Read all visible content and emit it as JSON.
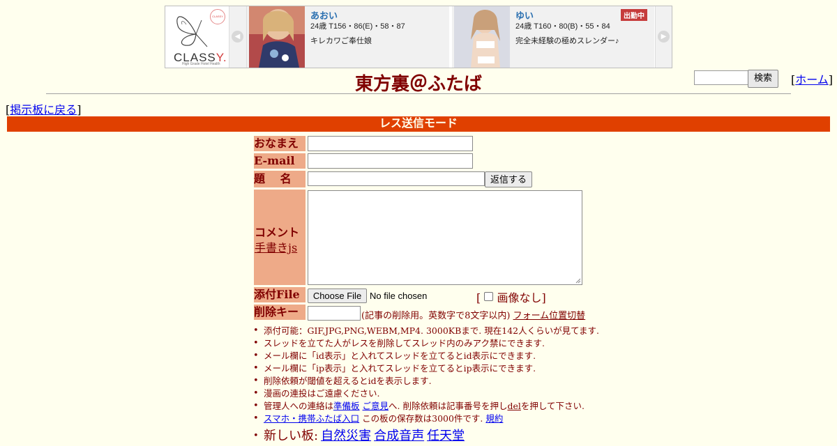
{
  "ad": {
    "logo_text": "CLASSY.",
    "logo_sub": "High Grade Hotel Health",
    "cards": [
      {
        "name": "あおい",
        "spec": "24歳 T156・86(E)・58・87",
        "desc": "キレカワご奉仕娘",
        "badge": ""
      },
      {
        "name": "ゆい",
        "spec": "24歳 T160・80(B)・55・84",
        "desc": "完全未経験の極めスレンダー♪",
        "badge": "出勤中"
      }
    ]
  },
  "header": {
    "title": "東方裏＠ふたば",
    "search_button": "検索",
    "home_prefix": "[",
    "home_link": "ホーム",
    "home_suffix": "]"
  },
  "nav": {
    "back_prefix": "[",
    "back_link": "掲示板に戻る",
    "back_suffix": "]"
  },
  "mode_banner": "レス送信モード",
  "form": {
    "name_label": "おなまえ",
    "email_label": "E-mail",
    "subject_label": "題　 名",
    "submit_button": "返信する",
    "comment_label": "コメント",
    "handwrite_link": "手書きjs",
    "file_label": "添付File",
    "file_button": "Choose File",
    "file_status": "No file chosen",
    "noimage_open": "[",
    "noimage_label": "画像なし",
    "noimage_close": "]",
    "delkey_label": "削除キー",
    "delkey_note": "(記事の削除用。英数字で8文字以内)",
    "form_toggle_link": "フォーム位置切替"
  },
  "notes": {
    "n1": "添付可能：GIF,JPG,PNG,WEBM,MP4. 3000KBまで. 現在142人くらいが見てます.",
    "n2": "スレッドを立てた人がレスを削除してスレッド内のみアク禁にできます.",
    "n3": "メール欄に「id表示」と入れてスレッドを立てるとid表示にできます.",
    "n4": "メール欄に「ip表示」と入れてスレッドを立てるとip表示にできます.",
    "n5": "削除依頼が閾値を超えるとidを表示します.",
    "n6": "漫画の連投はご遠慮ください.",
    "n7_a": "管理人への連絡は",
    "n7_link1": "準備板",
    "n7_link2": "ご意見",
    "n7_b": "へ. 削除依頼は記事番号を押し",
    "n7_link3": "del",
    "n7_c": "を押して下さい.",
    "n8_link": "スマホ・携帯ふたば入口",
    "n8_text": " この板の保存数は3000件です.",
    "n8_link2": "規約",
    "n9_prefix": "新しい板:",
    "n9_links": [
      "自然災害",
      "合成音声",
      "任天堂"
    ]
  }
}
